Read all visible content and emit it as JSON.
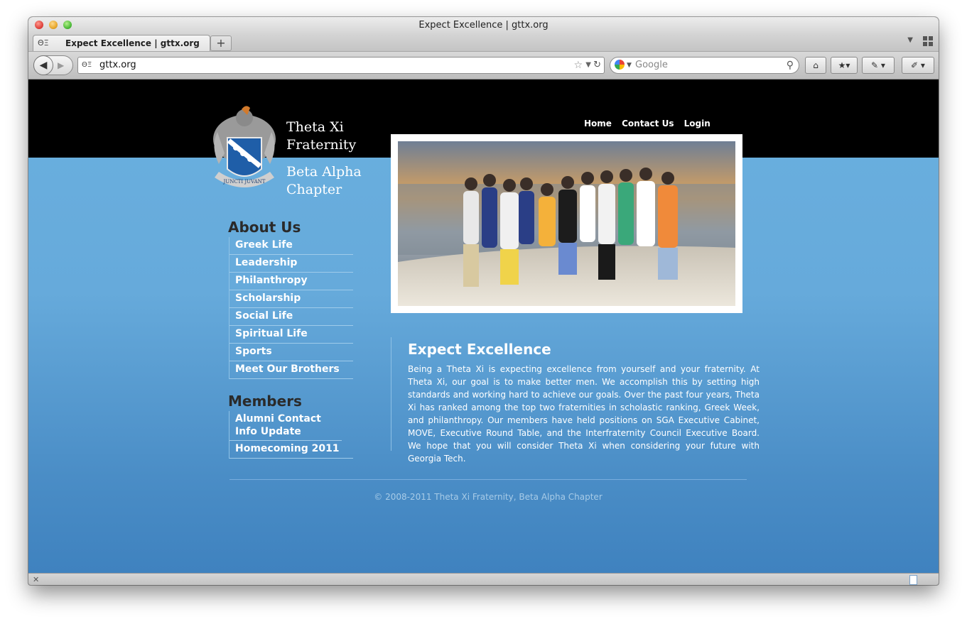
{
  "window": {
    "title": "Expect Excellence | gttx.org"
  },
  "tab": {
    "icon": "theta-xi-favicon",
    "title": "Expect Excellence | gttx.org",
    "new_tab_label": "+"
  },
  "navbar": {
    "url": "gttx.org",
    "search_placeholder": "Google",
    "buttons": [
      "home-icon",
      "bookmarks-icon",
      "addons-icon",
      "tools-icon"
    ]
  },
  "site": {
    "brand_line1": "Theta Xi",
    "brand_line2": "Fraternity",
    "brand_line3": "Beta Alpha",
    "brand_line4": "Chapter",
    "crest_motto": "JUNCTI JUVANT",
    "topnav": [
      "Home",
      "Contact Us",
      "Login"
    ]
  },
  "sidebar": {
    "about_title": "About Us",
    "about_items": [
      "Greek Life",
      "Leadership",
      "Philanthropy",
      "Scholarship",
      "Social Life",
      "Spiritual Life",
      "Sports",
      "Meet Our Brothers"
    ],
    "members_title": "Members",
    "members_items": [
      "Alumni Contact Info Update",
      "Homecoming 2011"
    ]
  },
  "content": {
    "title": "Expect Excellence",
    "body": "Being a Theta Xi is expecting excellence from yourself and your fraternity. At Theta Xi, our goal is to make better men. We accomplish this by setting high standards and working hard to achieve our goals. Over the past four years, Theta Xi has ranked among the top two fraternities in scholastic ranking, Greek Week, and philanthropy. Our members have held positions on SGA Executive Cabinet, MOVE, Executive Round Table, and the Interfraternity Council Executive Board. We hope that you will consider Theta Xi when considering your future with Georgia Tech."
  },
  "footer": {
    "text": "© 2008-2011 Theta Xi Fraternity, Beta Alpha Chapter"
  },
  "colors": {
    "header": "#000000",
    "page_blue": "#66aadb",
    "page_blue_bottom": "#3f82bf"
  }
}
